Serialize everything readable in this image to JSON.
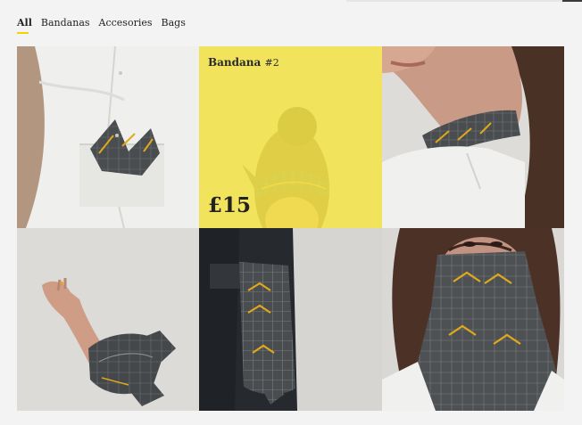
{
  "filters": [
    {
      "label": "All",
      "active": true
    },
    {
      "label": "Bandanas",
      "active": false
    },
    {
      "label": "Accesories",
      "active": false
    },
    {
      "label": "Bags",
      "active": false
    }
  ],
  "products": [
    {
      "image": "shirt-pocket-square",
      "name": "",
      "number": "",
      "price": ""
    },
    {
      "image": "hair-bandana",
      "name": "Bandana",
      "number": "#2",
      "price": "£15",
      "highlighted": true
    },
    {
      "image": "neck-scarf",
      "name": "",
      "number": "",
      "price": ""
    },
    {
      "image": "wrist-bandana",
      "name": "",
      "number": "",
      "price": ""
    },
    {
      "image": "pocket-hanging-bandana",
      "name": "",
      "number": "",
      "price": ""
    },
    {
      "image": "face-mask-bandana",
      "name": "",
      "number": "",
      "price": ""
    }
  ],
  "colors": {
    "accent": "#f4d400",
    "overlay": "#f5e448",
    "pattern_dark": "#4a4d50",
    "pattern_gold": "#e0a91a"
  }
}
